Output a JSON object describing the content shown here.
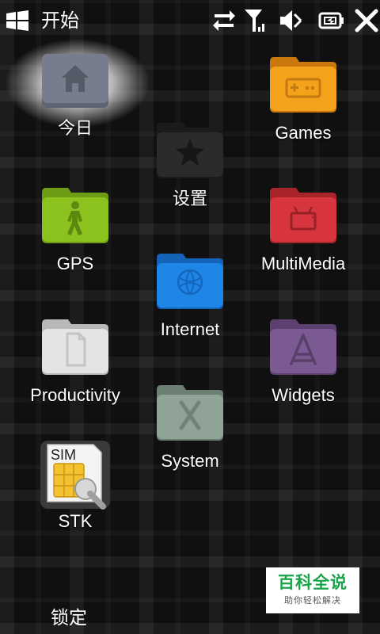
{
  "status_bar": {
    "title": "开始",
    "icons": [
      "windows-start-icon",
      "sync-arrows-icon",
      "signal-antenna-icon",
      "speaker-muted-icon",
      "battery-charging-icon",
      "close-icon"
    ]
  },
  "tiles": {
    "today": {
      "label": "今日",
      "icon": "home-icon",
      "color": "#7a7f8e",
      "selected": true
    },
    "settings": {
      "label": "设置",
      "icon": "star-icon",
      "color": "#2a2a2c"
    },
    "games": {
      "label": "Games",
      "icon": "gamepad-icon",
      "color": "#f2a21b"
    },
    "gps": {
      "label": "GPS",
      "icon": "walker-icon",
      "color": "#8bc21e"
    },
    "multimedia": {
      "label": "MultiMedia",
      "icon": "tv-icon",
      "color": "#d8363e"
    },
    "internet": {
      "label": "Internet",
      "icon": "globe-icon",
      "color": "#1e86e6"
    },
    "productivity": {
      "label": "Productivity",
      "icon": "document-icon",
      "color": "#e2e2e2"
    },
    "widgets": {
      "label": "Widgets",
      "icon": "app-a-icon",
      "color": "#7b5a93"
    },
    "system": {
      "label": "System",
      "icon": "x-icon",
      "color": "#8fa396"
    },
    "stk": {
      "label": "STK",
      "icon": "sim-card-icon",
      "badge_text": "SIM"
    }
  },
  "bottom": {
    "lock_label": "锁定"
  },
  "watermark": {
    "main": "百科全说",
    "sub": "助你轻松解决"
  }
}
